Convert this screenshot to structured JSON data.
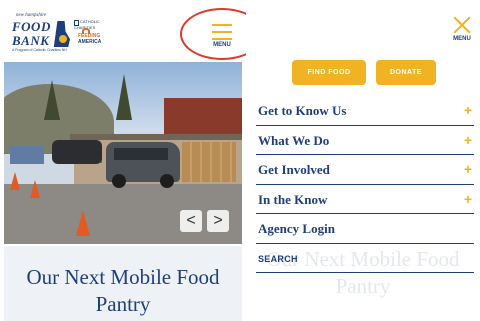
{
  "logo": {
    "line1": "new hampshire",
    "line2": "FOOD",
    "line3": "BANK",
    "line4": "A Program of Catholic Charities NH"
  },
  "partners": {
    "catholic_charities": "CATHOLIC CHARITIES",
    "feeding": "FEEDING",
    "america": "AMERICA"
  },
  "header": {
    "menu_label": "MENU"
  },
  "carousel": {
    "prev": "<",
    "next": ">"
  },
  "hero": {
    "title": "Our Next Mobile Food Pantry"
  },
  "menu_panel": {
    "menu_label": "MENU",
    "buttons": {
      "find_food": "FIND FOOD",
      "donate": "DONATE"
    },
    "items": [
      {
        "label": "Get to Know Us",
        "expand": "+"
      },
      {
        "label": "What We Do",
        "expand": "+"
      },
      {
        "label": "Get Involved",
        "expand": "+"
      },
      {
        "label": "In the Know",
        "expand": "+"
      },
      {
        "label": "Agency Login",
        "expand": ""
      },
      {
        "label": "SEARCH",
        "expand": ""
      }
    ]
  },
  "colors": {
    "navy": "#1f3f7a",
    "gold": "#f0b323",
    "annotation_red": "#e03a2a"
  }
}
